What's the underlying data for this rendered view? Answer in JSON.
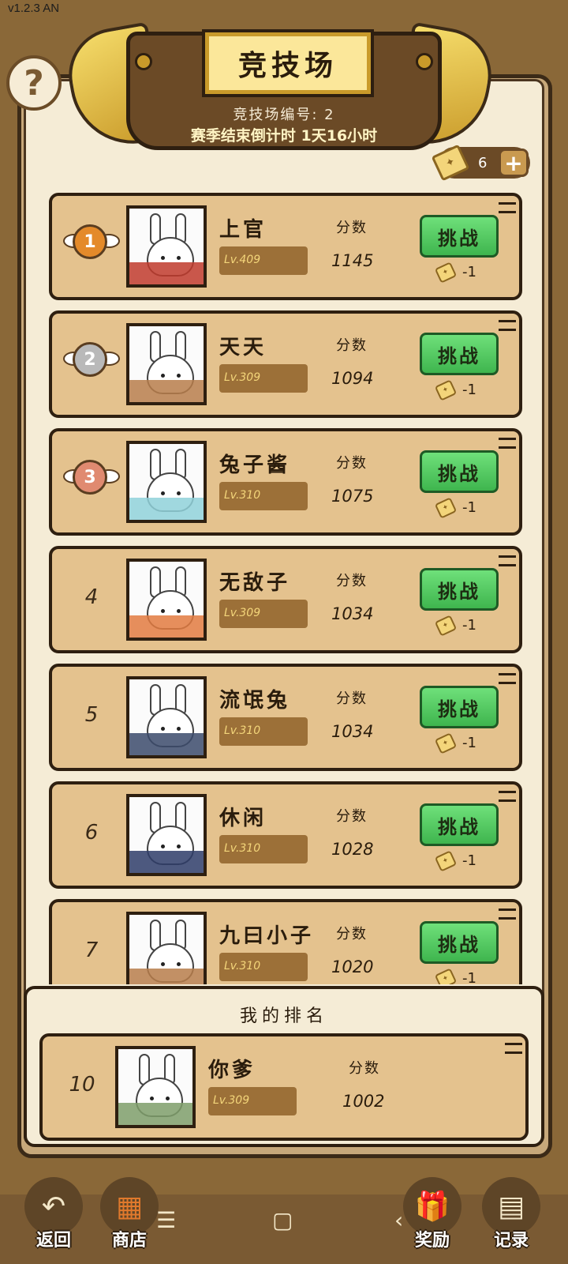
{
  "status_bar": {
    "version": "v1.2.3 AN"
  },
  "header": {
    "title": "竞技场",
    "arena_number": "竞技场编号: 2",
    "season_countdown": "赛季结束倒计时 1天16小时",
    "help_symbol": "?"
  },
  "tickets": {
    "count": "6",
    "plus_symbol": "+",
    "icon": "ticket-icon"
  },
  "labels": {
    "score": "分数",
    "challenge": "挑战",
    "cost": "-1"
  },
  "rankings": [
    {
      "rank": "1",
      "medal": "gold",
      "name": "上官",
      "level": "Lv.409",
      "score": "1145",
      "accent": "#c0392b"
    },
    {
      "rank": "2",
      "medal": "silver",
      "name": "天天",
      "level": "Lv.309",
      "score": "1094",
      "accent": "#b77d4a"
    },
    {
      "rank": "3",
      "medal": "bronze",
      "name": "兔子酱",
      "level": "Lv.310",
      "score": "1075",
      "accent": "#8fd1d9"
    },
    {
      "rank": "4",
      "medal": "",
      "name": "无敌子",
      "level": "Lv.309",
      "score": "1034",
      "accent": "#e27a3f"
    },
    {
      "rank": "5",
      "medal": "",
      "name": "流氓兔",
      "level": "Lv.310",
      "score": "1034",
      "accent": "#3b4a6b"
    },
    {
      "rank": "6",
      "medal": "",
      "name": "休闲",
      "level": "Lv.310",
      "score": "1028",
      "accent": "#2e3c68"
    },
    {
      "rank": "7",
      "medal": "",
      "name": "九曰小子",
      "level": "Lv.310",
      "score": "1020",
      "accent": "#b77d4a"
    }
  ],
  "my_ranking": {
    "title": "我的排名",
    "rank": "10",
    "name": "你爹",
    "level": "Lv.309",
    "score": "1002",
    "accent": "#7e9d6a"
  },
  "bottom_nav": {
    "back": "返回",
    "shop": "商店",
    "rewards": "奖励",
    "records": "记录"
  }
}
